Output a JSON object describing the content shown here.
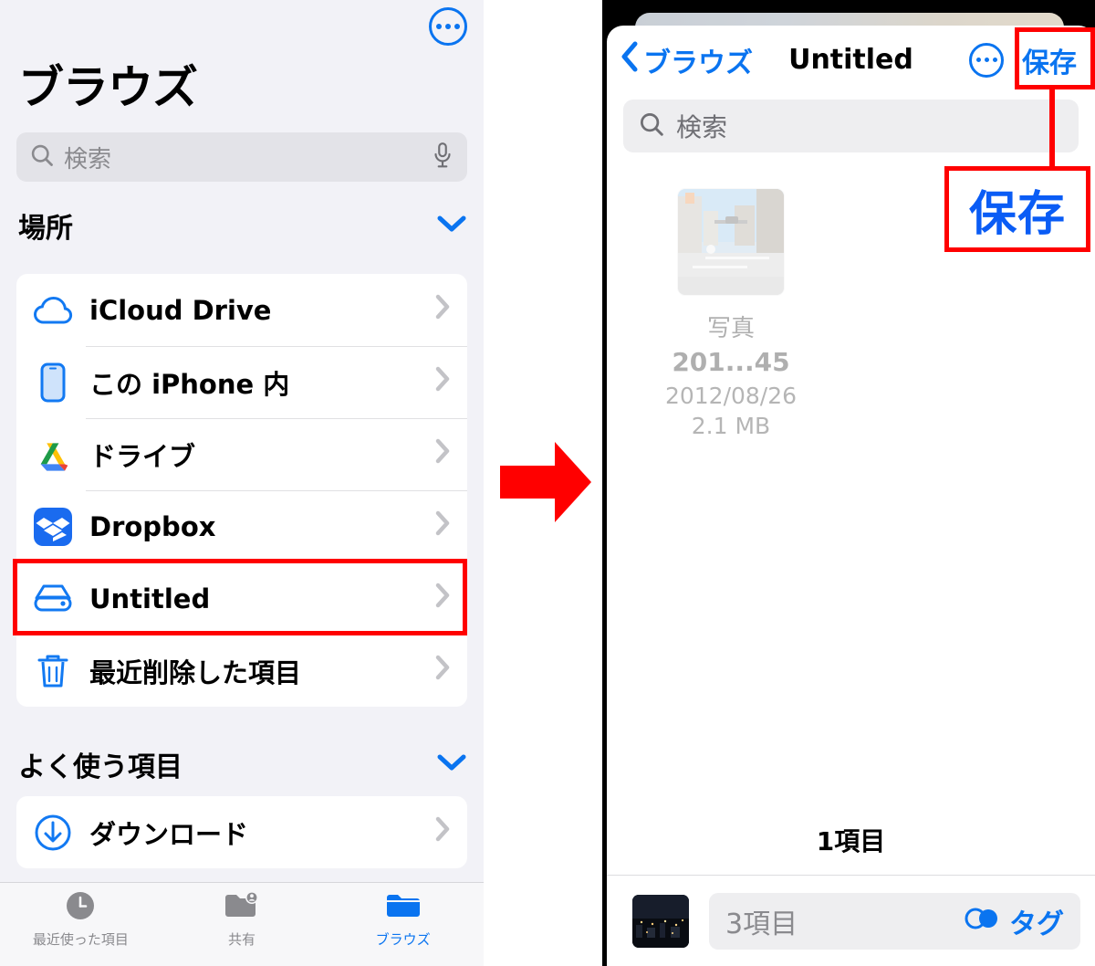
{
  "left": {
    "more_button": "more-options",
    "title": "ブラウズ",
    "search": {
      "placeholder": "検索"
    },
    "sections": [
      {
        "header": "場所",
        "items": [
          {
            "label": "iCloud Drive",
            "icon": "icloud-icon"
          },
          {
            "label": "この iPhone 内",
            "icon": "iphone-icon"
          },
          {
            "label": "ドライブ",
            "icon": "google-drive-icon"
          },
          {
            "label": "Dropbox",
            "icon": "dropbox-icon"
          },
          {
            "label": "Untitled",
            "icon": "external-drive-icon",
            "highlighted": true
          },
          {
            "label": "最近削除した項目",
            "icon": "trash-icon"
          }
        ]
      },
      {
        "header": "よく使う項目",
        "items": [
          {
            "label": "ダウンロード",
            "icon": "download-icon"
          }
        ]
      }
    ],
    "tabs": [
      {
        "label": "最近使った項目",
        "icon": "clock-icon",
        "active": false
      },
      {
        "label": "共有",
        "icon": "shared-folder-icon",
        "active": false
      },
      {
        "label": "ブラウズ",
        "icon": "folder-icon",
        "active": true
      }
    ]
  },
  "right": {
    "nav": {
      "back_label": "ブラウズ",
      "title": "Untitled",
      "more_button": "more-options",
      "save_label": "保存"
    },
    "search": {
      "placeholder": "検索"
    },
    "file": {
      "kind": "写真",
      "name": "201...45",
      "date": "2012/08/26",
      "size": "2.1 MB"
    },
    "item_count": "1項目",
    "bottom_bar": {
      "field_value": "3項目",
      "tag_label": "タグ"
    }
  },
  "annotation": {
    "arrow": "right-arrow",
    "callout_text": "保存",
    "accent_color": "#0a74f0",
    "highlight_color": "#ff0000"
  }
}
